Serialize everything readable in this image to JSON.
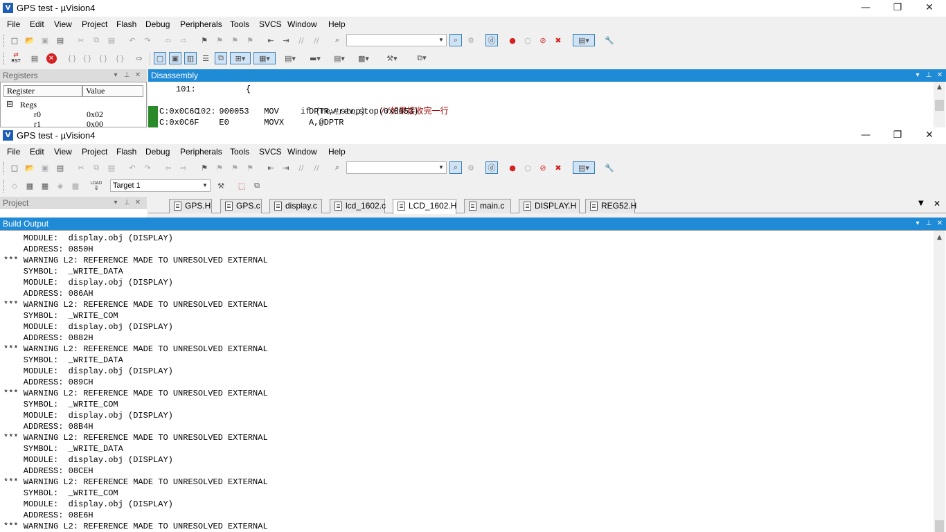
{
  "app_title": "GPS test  - µVision4",
  "app_icon_text": "V",
  "window_controls": {
    "minimize": "—",
    "maximize": "❐",
    "close": "✕"
  },
  "menu": [
    "File",
    "Edit",
    "View",
    "Project",
    "Flash",
    "Debug",
    "Peripherals",
    "Tools",
    "SVCS",
    "Window",
    "Help"
  ],
  "debug_toolbar": {
    "rst_label": "RST"
  },
  "registers_panel": {
    "title": "Registers",
    "columns": [
      "Register",
      "Value"
    ],
    "group": "Regs",
    "rows": [
      {
        "name": "r0",
        "value": "0x02"
      },
      {
        "name": "r1",
        "value": "0x00"
      }
    ]
  },
  "disassembly_panel": {
    "title": "Disassembly",
    "lines": [
      "101:          {",
      "102:                 if (rev_stop)   //如果接收完一行",
      "C:0x0C6C    900053   MOV      DPTR,#rev_stop(0x0053)",
      "C:0x0C6F    E0       MOVX     A,@DPTR"
    ]
  },
  "build_toolbar": {
    "target": "Target 1",
    "load_label": "LOAD"
  },
  "project_panel": {
    "title": "Project"
  },
  "file_tabs": [
    "GPS.H",
    "GPS.c",
    "display.c",
    "lcd_1602.c",
    "LCD_1602.H",
    "main.c",
    "DISPLAY.H",
    "REG52.H"
  ],
  "active_tab": "LCD_1602.H",
  "panel_buttons": {
    "dropdown": "▾",
    "pin": "⊥",
    "close": "✕"
  },
  "tab_controls": {
    "dropdown": "▼",
    "close": "✕"
  },
  "build_output": {
    "title": "Build Output",
    "lines": [
      "    MODULE:  display.obj (DISPLAY)",
      "    ADDRESS: 0850H",
      "*** WARNING L2: REFERENCE MADE TO UNRESOLVED EXTERNAL",
      "    SYMBOL:  _WRITE_DATA",
      "    MODULE:  display.obj (DISPLAY)",
      "    ADDRESS: 086AH",
      "*** WARNING L2: REFERENCE MADE TO UNRESOLVED EXTERNAL",
      "    SYMBOL:  _WRITE_COM",
      "    MODULE:  display.obj (DISPLAY)",
      "    ADDRESS: 0882H",
      "*** WARNING L2: REFERENCE MADE TO UNRESOLVED EXTERNAL",
      "    SYMBOL:  _WRITE_DATA",
      "    MODULE:  display.obj (DISPLAY)",
      "    ADDRESS: 089CH",
      "*** WARNING L2: REFERENCE MADE TO UNRESOLVED EXTERNAL",
      "    SYMBOL:  _WRITE_COM",
      "    MODULE:  display.obj (DISPLAY)",
      "    ADDRESS: 08B4H",
      "*** WARNING L2: REFERENCE MADE TO UNRESOLVED EXTERNAL",
      "    SYMBOL:  _WRITE_DATA",
      "    MODULE:  display.obj (DISPLAY)",
      "    ADDRESS: 08CEH",
      "*** WARNING L2: REFERENCE MADE TO UNRESOLVED EXTERNAL",
      "    SYMBOL:  _WRITE_COM",
      "    MODULE:  display.obj (DISPLAY)",
      "    ADDRESS: 08E6H",
      "*** WARNING L2: REFERENCE MADE TO UNRESOLVED EXTERNAL"
    ]
  },
  "colors": {
    "accent": "#1f8ad6",
    "breakpoint": "#e02020",
    "current_line": "#2a8a2a",
    "comment": "#a00000"
  }
}
